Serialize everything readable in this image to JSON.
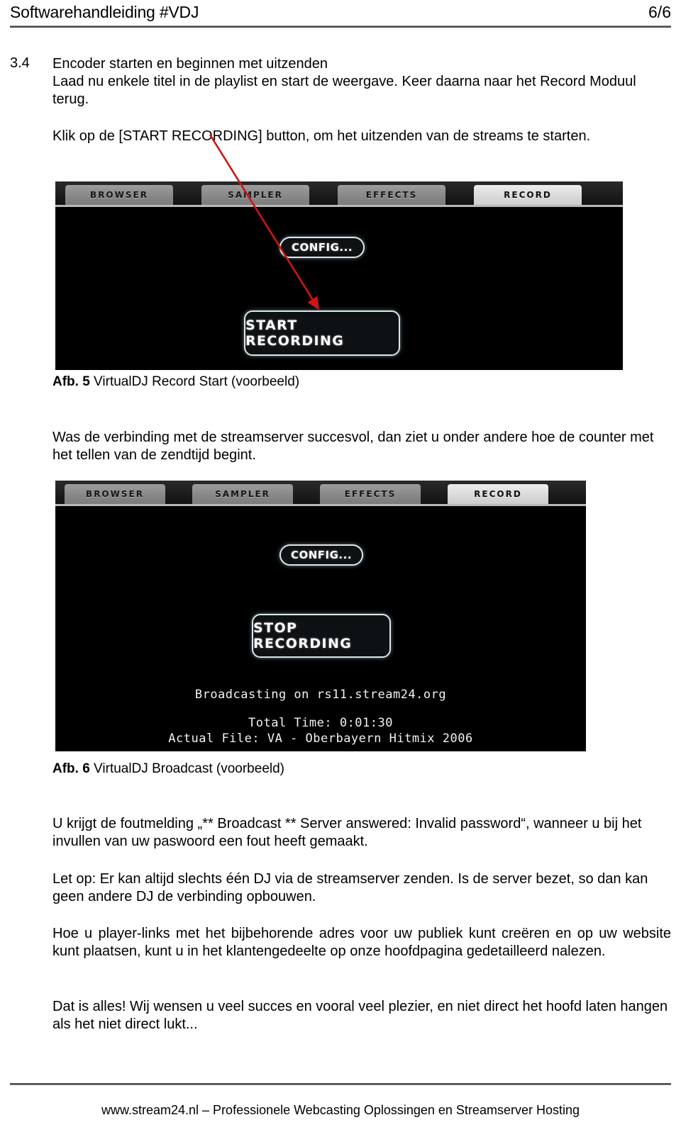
{
  "header": {
    "title": "Softwarehandleiding #VDJ",
    "page_number": "6/6"
  },
  "section": {
    "number": "3.4",
    "heading": "Encoder starten en beginnen met uitzenden",
    "intro": "Laad nu enkele titel in de playlist en start de weergave. Keer daarna naar het Record Moduul terug."
  },
  "paragraphs": {
    "klik": "Klik op de [START RECORDING] button, om het uitzenden van de streams te starten.",
    "was": "Was de verbinding met de streamserver succesvol, dan ziet u onder andere hoe de counter met het tellen van de zendtijd begint.",
    "error": "U krijgt de foutmelding „** Broadcast ** Server answered: Invalid password“, wanneer u bij het invullen van uw paswoord een fout heeft gemaakt.",
    "letop": "Let op: Er kan altijd slechts één DJ via de streamserver zenden.  Is de server bezet, so dan kan geen andere DJ de verbinding opbouwen.",
    "hoe": "Hoe u player-links met het bijbehorende adres voor uw publiek kunt creëren en op uw website kunt plaatsen, kunt u in het klantengedeelte op onze hoofdpagina gedetailleerd nalezen.",
    "dat": "Dat is alles! Wij wensen u veel succes en vooral veel plezier, en niet direct het hoofd laten hangen als het niet direct lukt..."
  },
  "captions": {
    "fig5_label": "Afb. 5",
    "fig5_text": " VirtualDJ Record Start (voorbeeld)",
    "fig6_label": "Afb. 6",
    "fig6_text": " VirtualDJ Broadcast (voorbeeld)"
  },
  "screenshot_start": {
    "tabs": [
      {
        "label": "BROWSER",
        "active": false
      },
      {
        "label": "SAMPLER",
        "active": false
      },
      {
        "label": "EFFECTS",
        "active": false
      },
      {
        "label": "RECORD",
        "active": true
      }
    ],
    "config_button": "CONFIG...",
    "record_button": "START RECORDING"
  },
  "screenshot_broadcast": {
    "tabs": [
      {
        "label": "BROWSER",
        "active": false
      },
      {
        "label": "SAMPLER",
        "active": false
      },
      {
        "label": "EFFECTS",
        "active": false
      },
      {
        "label": "RECORD",
        "active": true
      }
    ],
    "config_button": "CONFIG...",
    "record_button": "STOP RECORDING",
    "status_broadcasting": "Broadcasting on rs11.stream24.org",
    "status_total_time": "Total Time: 0:01:30",
    "status_actual_file": "Actual File: VA - Oberbayern Hitmix 2006"
  },
  "annotation": {
    "arrow_color": "#d01414"
  },
  "footer": {
    "text": "www.stream24.nl – Professionele Webcasting Oplossingen en Streamserver Hosting"
  }
}
